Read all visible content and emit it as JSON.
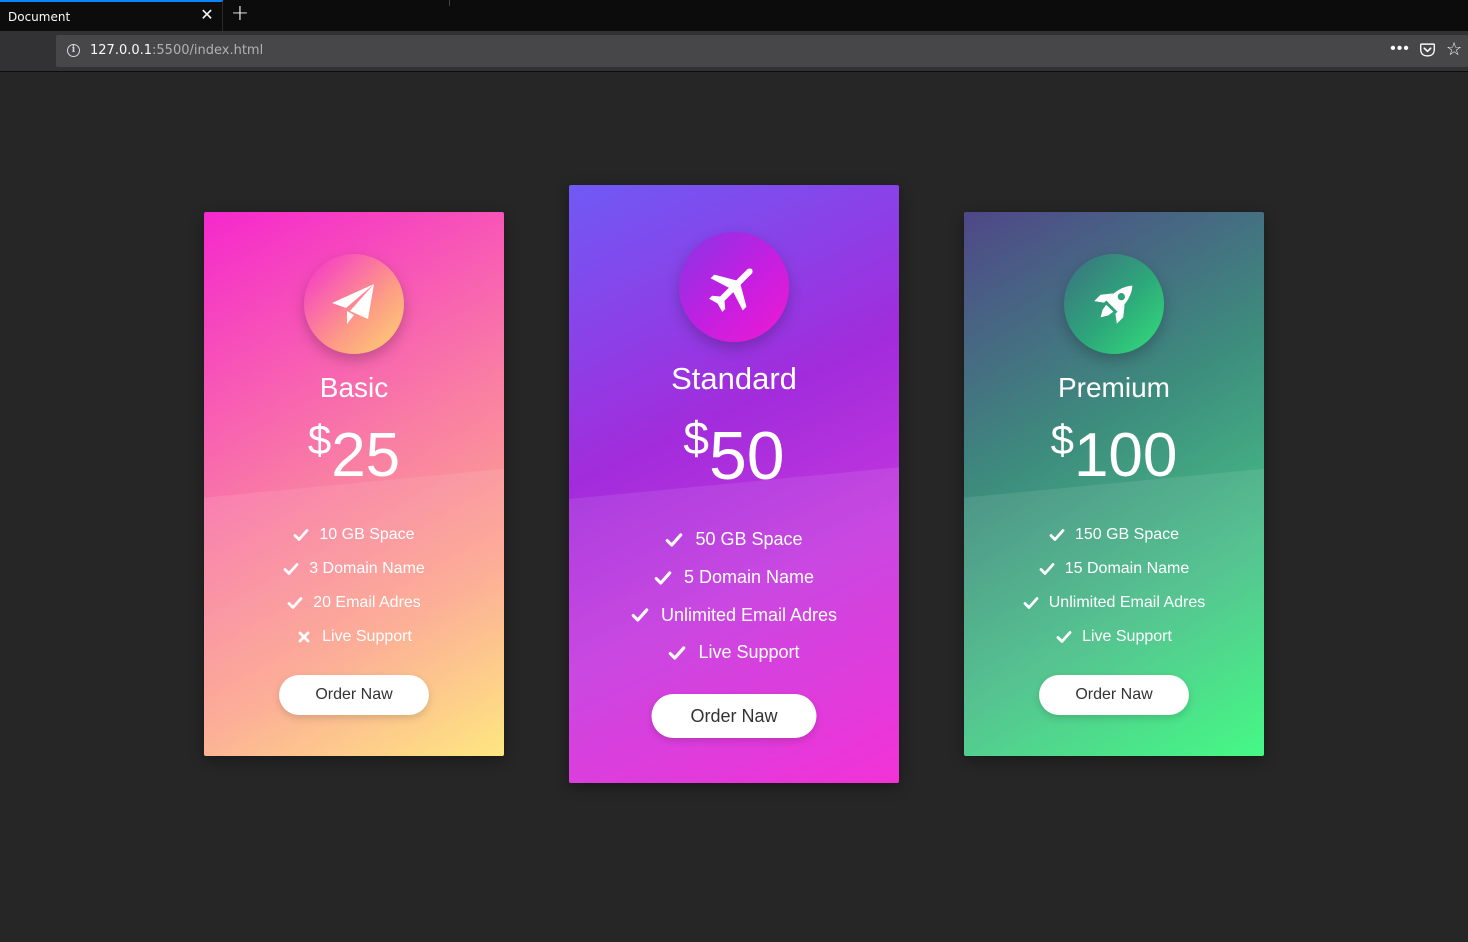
{
  "browser": {
    "tab_title": "Document",
    "close_glyph": "✕",
    "new_tab_glyph": "+",
    "url_host": "127.0.0.1",
    "url_rest": ":5500/index.html",
    "more_glyph": "•••",
    "star_glyph": "☆"
  },
  "pricing": {
    "plans": [
      {
        "name": "Basic",
        "currency": "$",
        "price": "25",
        "icon": "paper-plane-icon",
        "features": [
          {
            "label": "10 GB Space",
            "included": true
          },
          {
            "label": "3 Domain Name",
            "included": true
          },
          {
            "label": "20 Email Adres",
            "included": true
          },
          {
            "label": "Live Support",
            "included": false
          }
        ],
        "button": "Order Naw"
      },
      {
        "name": "Standard",
        "currency": "$",
        "price": "50",
        "icon": "airplane-icon",
        "features": [
          {
            "label": "50 GB Space",
            "included": true
          },
          {
            "label": "5 Domain Name",
            "included": true
          },
          {
            "label": "Unlimited Email Adres",
            "included": true
          },
          {
            "label": "Live Support",
            "included": true
          }
        ],
        "button": "Order Naw"
      },
      {
        "name": "Premium",
        "currency": "$",
        "price": "100",
        "icon": "rocket-icon",
        "features": [
          {
            "label": "150 GB Space",
            "included": true
          },
          {
            "label": "15 Domain Name",
            "included": true
          },
          {
            "label": "Unlimited Email Adres",
            "included": true
          },
          {
            "label": "Live Support",
            "included": true
          }
        ],
        "button": "Order Naw"
      }
    ]
  },
  "colors": {
    "page_background": "#262626",
    "basic_gradient": [
      "#f528cd",
      "#fee574"
    ],
    "standard_gradient": [
      "#6f5af5",
      "#f21ed4"
    ],
    "premium_gradient": [
      "#4f4788",
      "#33f97a"
    ],
    "button_background": "#ffffff",
    "button_text": "#333333"
  }
}
